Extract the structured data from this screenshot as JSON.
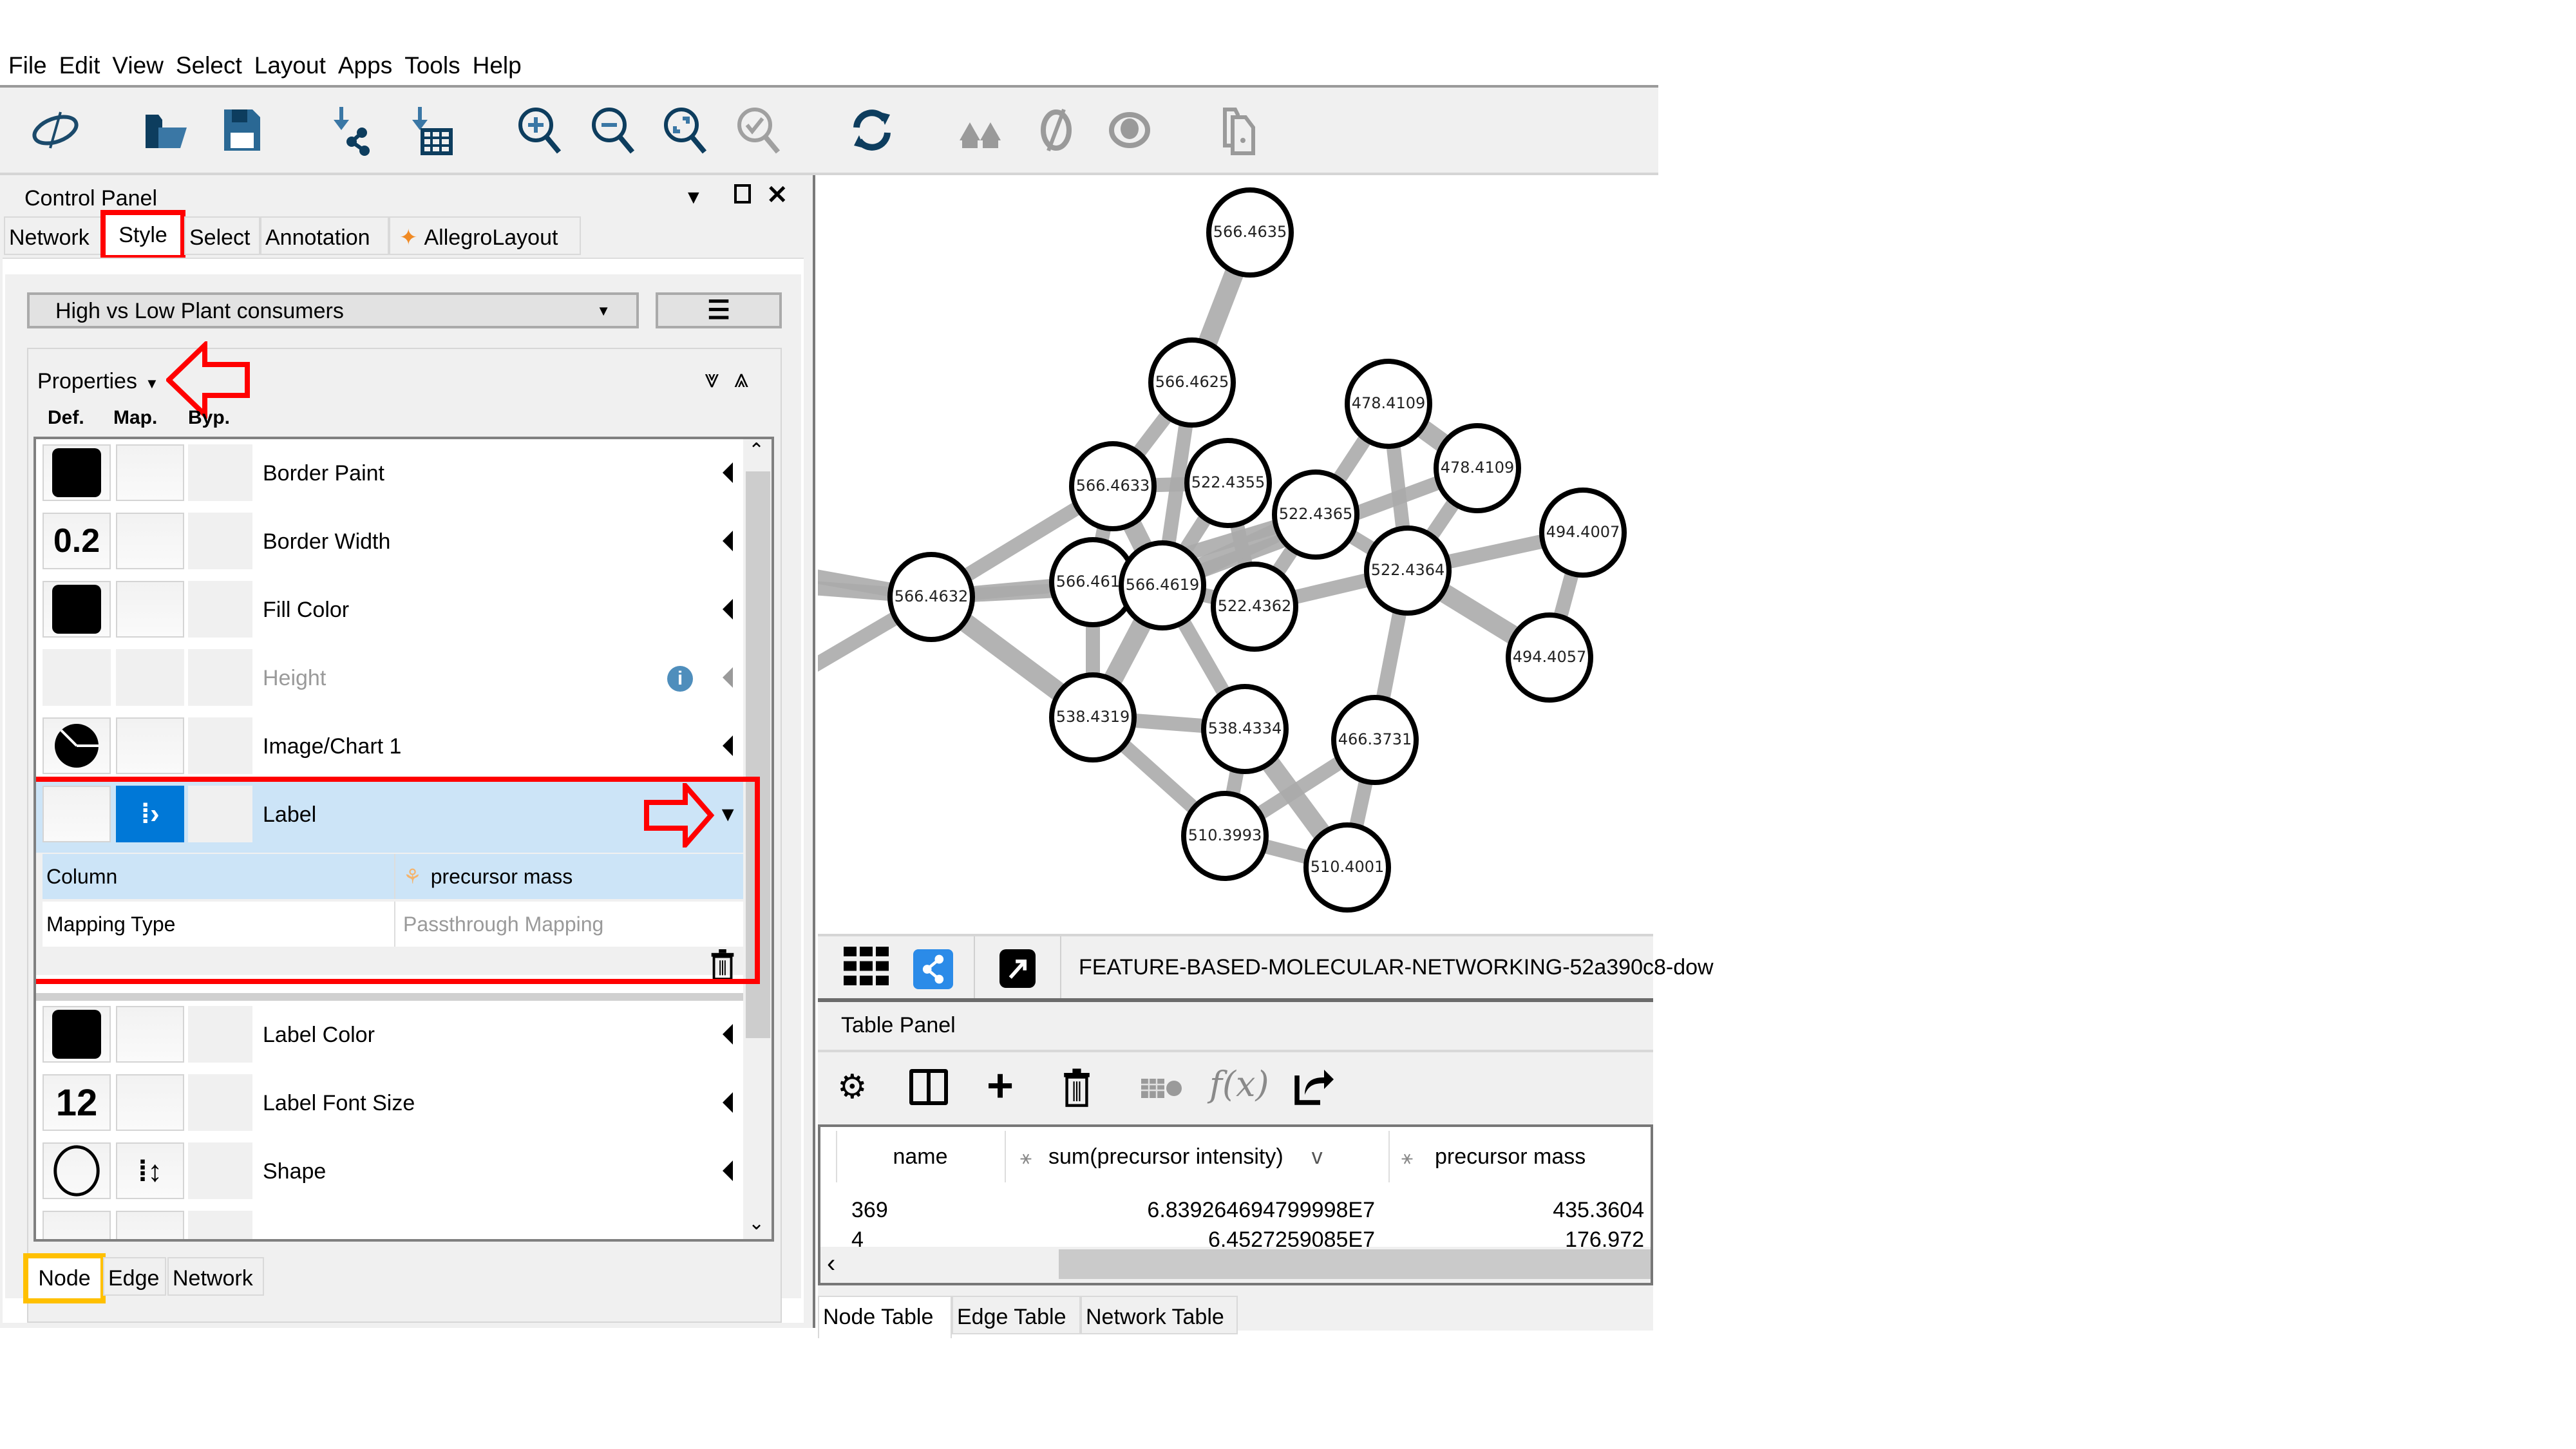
{
  "menu": [
    "File",
    "Edit",
    "View",
    "Select",
    "Layout",
    "Apps",
    "Tools",
    "Help"
  ],
  "toolbar": {
    "icons": [
      "cytoscape-logo-icon",
      "open-folder-icon",
      "save-icon",
      "import-network-icon",
      "import-table-icon",
      "zoom-in-icon",
      "zoom-out-icon",
      "zoom-fit-icon",
      "zoom-selected-icon",
      "refresh-icon",
      "first-neighbors-icon",
      "hide-icon",
      "show-icon",
      "export-network-image-icon"
    ]
  },
  "control_panel": {
    "title": "Control Panel",
    "tabs": [
      "Network",
      "Style",
      "Select",
      "Annotation",
      "AllegroLayout"
    ],
    "active_tab": "Style",
    "style_name": "High vs Low Plant consumers",
    "properties_label": "Properties",
    "column_headers": {
      "def": "Def.",
      "map": "Map.",
      "byp": "Byp."
    },
    "properties": [
      {
        "name": "Border Paint",
        "default": "black-swatch"
      },
      {
        "name": "Border Width",
        "default": "0.2"
      },
      {
        "name": "Fill Color",
        "default": "black-swatch"
      },
      {
        "name": "Height",
        "default": "",
        "disabled": true
      },
      {
        "name": "Image/Chart 1",
        "default": "pie-chart"
      },
      {
        "name": "Label",
        "default": "",
        "mapped": true,
        "expanded": true
      },
      {
        "name": "Label Color",
        "default": "black-swatch"
      },
      {
        "name": "Label Font Size",
        "default": "12"
      },
      {
        "name": "Shape",
        "default": "ellipse",
        "mapped": true
      }
    ],
    "label_mapping": {
      "column_key": "Column",
      "column_value": "precursor mass",
      "mapping_type_key": "Mapping Type",
      "mapping_type_value": "Passthrough Mapping"
    },
    "bottom_tabs": [
      "Node",
      "Edge",
      "Network"
    ],
    "active_bottom_tab": "Node"
  },
  "network": {
    "title": "FEATURE-BASED-MOLECULAR-NETWORKING-52a390c8-dow",
    "nodes": [
      {
        "id": "n1",
        "label": "566.4635"
      },
      {
        "id": "n2",
        "label": "566.4625"
      },
      {
        "id": "n3",
        "label": "478.4109"
      },
      {
        "id": "n4",
        "label": "478.4109"
      },
      {
        "id": "n5",
        "label": "566.4633"
      },
      {
        "id": "n6",
        "label": "522.4355"
      },
      {
        "id": "n7",
        "label": "522.4365"
      },
      {
        "id": "n8",
        "label": "494.4007"
      },
      {
        "id": "n9",
        "label": "566.4632"
      },
      {
        "id": "n10",
        "label": "566.4613"
      },
      {
        "id": "n11",
        "label": "566.4619"
      },
      {
        "id": "n12",
        "label": "522.4364"
      },
      {
        "id": "n13",
        "label": "522.4362"
      },
      {
        "id": "n14",
        "label": "494.4057"
      },
      {
        "id": "n15",
        "label": "538.4319"
      },
      {
        "id": "n16",
        "label": "538.4334"
      },
      {
        "id": "n17",
        "label": "466.3731"
      },
      {
        "id": "n18",
        "label": "510.3993"
      },
      {
        "id": "n19",
        "label": "510.4001"
      }
    ],
    "edges": [
      [
        "n1",
        "n2"
      ],
      [
        "n2",
        "n5"
      ],
      [
        "n2",
        "n11"
      ],
      [
        "n5",
        "n9"
      ],
      [
        "n5",
        "n6"
      ],
      [
        "n5",
        "n11"
      ],
      [
        "n5",
        "n10"
      ],
      [
        "n6",
        "n11"
      ],
      [
        "n6",
        "n13"
      ],
      [
        "n3",
        "n7"
      ],
      [
        "n3",
        "n4"
      ],
      [
        "n3",
        "n12"
      ],
      [
        "n4",
        "n12"
      ],
      [
        "n4",
        "n11"
      ],
      [
        "n7",
        "n12"
      ],
      [
        "n7",
        "n11"
      ],
      [
        "n7",
        "n10"
      ],
      [
        "n7",
        "n13"
      ],
      [
        "n8",
        "n12"
      ],
      [
        "n8",
        "n14"
      ],
      [
        "n12",
        "n14"
      ],
      [
        "n12",
        "n13"
      ],
      [
        "n12",
        "n17"
      ],
      [
        "n9",
        "n10"
      ],
      [
        "n9",
        "n11"
      ],
      [
        "n9",
        "n15"
      ],
      [
        "n9",
        "offL1"
      ],
      [
        "n9",
        "offL2"
      ],
      [
        "n9",
        "offL3"
      ],
      [
        "n10",
        "n15"
      ],
      [
        "n11",
        "n15"
      ],
      [
        "n11",
        "n16"
      ],
      [
        "n15",
        "n16"
      ],
      [
        "n15",
        "n18"
      ],
      [
        "n16",
        "n18"
      ],
      [
        "n16",
        "n19"
      ],
      [
        "n17",
        "n18"
      ],
      [
        "n17",
        "n19"
      ],
      [
        "n18",
        "n19"
      ],
      [
        "n13",
        "n11"
      ]
    ]
  },
  "network_bar": {
    "icons": [
      "grid-view-icon",
      "network-view-icon",
      "detach-view-icon"
    ]
  },
  "table_panel": {
    "title": "Table Panel",
    "tools": [
      "settings-icon",
      "column-toggle-icon",
      "add-column-icon",
      "delete-column-icon",
      "link-table-icon",
      "function-builder-icon",
      "export-table-icon"
    ],
    "function_label": "f(x)",
    "columns": [
      "name",
      "sum(precursor intensity)",
      "precursor mass"
    ],
    "sort_indicator": "v",
    "rows": [
      [
        "369",
        "6.839264694799998E7",
        "435.3604"
      ],
      [
        "4",
        "6.4527259085E7",
        "176.972"
      ]
    ],
    "tabs": [
      "Node Table",
      "Edge Table",
      "Network Table"
    ],
    "active_tab": "Node Table"
  },
  "annotations": {
    "highlight_color_red": "#ff0000",
    "highlight_color_yellow": "#ffc000",
    "accent_blue": "#0078d7",
    "selected_row_bg": "#cce4f7"
  }
}
